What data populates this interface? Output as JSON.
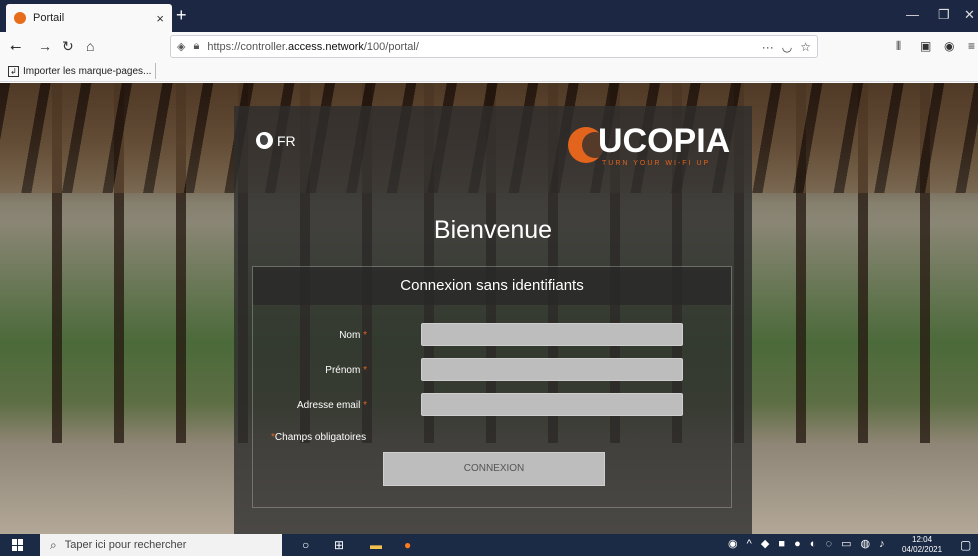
{
  "browser": {
    "tab_title": "Portail",
    "tab_close": "×",
    "new_tab": "+",
    "url_prefix": "https://controller.",
    "url_host": "access.network",
    "url_path": "/100/portal/",
    "page_actions": "···",
    "bookmark_label": "Importer les marque-pages..."
  },
  "portal": {
    "language": "FR",
    "brand": "UCOPIA",
    "tagline": "TURN YOUR WI-FI UP",
    "welcome": "Bienvenue",
    "form_title": "Connexion sans identifiants",
    "fields": [
      {
        "label": "Nom",
        "value": ""
      },
      {
        "label": "Prénom",
        "value": ""
      },
      {
        "label": "Adresse email",
        "value": ""
      }
    ],
    "required_mark": "*",
    "required_note": "Champs obligatoires",
    "submit_label": "CONNEXION"
  },
  "taskbar": {
    "search_placeholder": "Taper ici pour rechercher",
    "time": "12:04",
    "date": "04/02/2021"
  },
  "colors": {
    "accent": "#e2641d",
    "panel": "#2d2d2d",
    "taskbar": "#1b2b45",
    "titlebar": "#1c2743"
  }
}
